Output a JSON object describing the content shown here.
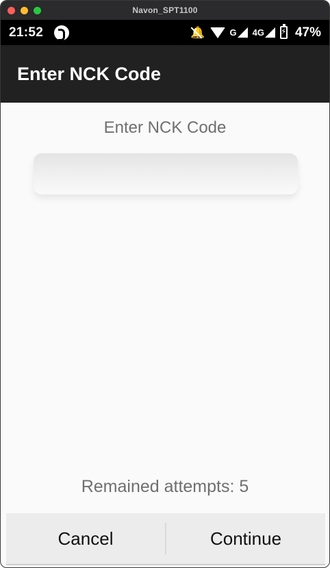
{
  "window": {
    "title": "Navon_SPT1100"
  },
  "status_bar": {
    "time": "21:52",
    "network_1": "G",
    "network_2": "4G",
    "battery_percent": "47%"
  },
  "app_bar": {
    "title": "Enter NCK Code"
  },
  "content": {
    "prompt": "Enter NCK Code",
    "code_input_value": "",
    "attempts_text": "Remained attempts: 5"
  },
  "buttons": {
    "cancel_label": "Cancel",
    "continue_label": "Continue"
  },
  "colors": {
    "appbar_bg": "#212121",
    "statusbar_bg": "#000000",
    "content_bg": "#fafafa",
    "button_bar_bg": "#ececec",
    "secondary_text": "#6f6f6f"
  }
}
